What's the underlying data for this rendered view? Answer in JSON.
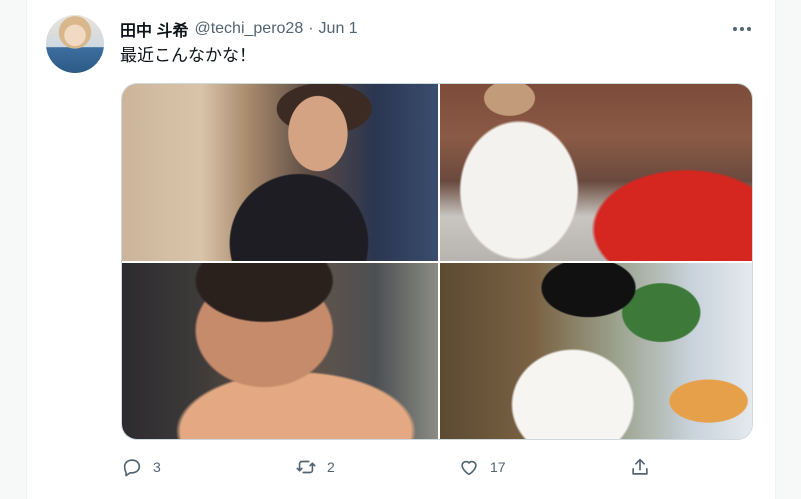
{
  "tweet": {
    "display_name": "田中 斗希",
    "handle": "@techi_pero28",
    "separator": "·",
    "date": "Jun 1",
    "text": "最近こんなかな！",
    "media": [
      {
        "icon": "photo"
      },
      {
        "icon": "photo"
      },
      {
        "icon": "photo"
      },
      {
        "icon": "photo"
      }
    ],
    "actions": {
      "reply_count": "3",
      "retweet_count": "2",
      "like_count": "17"
    }
  },
  "colors": {
    "text_primary": "#0f1419",
    "text_secondary": "#536471",
    "border": "#cfd9de",
    "background": "#ffffff"
  }
}
